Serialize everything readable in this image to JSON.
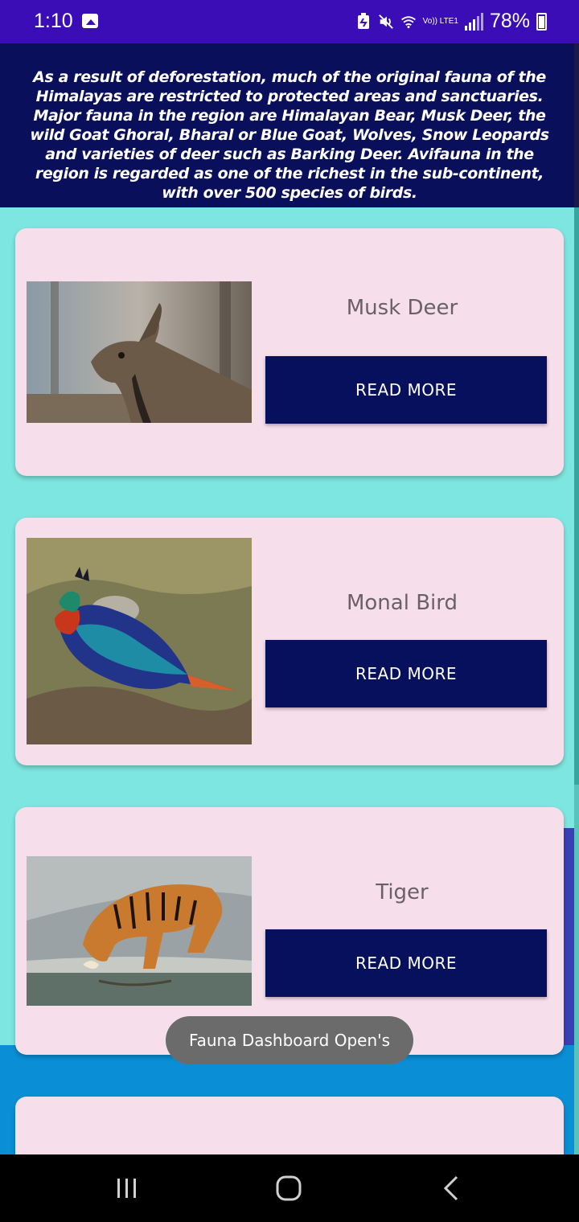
{
  "status_bar": {
    "time": "1:10",
    "battery": "78%",
    "icons": [
      "image-icon",
      "battery-saver-icon",
      "mute-icon",
      "wifi-icon",
      "volte-lte-icon",
      "signal-icon",
      "battery-icon"
    ],
    "volte_label": "Vo)) LTE1"
  },
  "header": {
    "text": "As a result of deforestation, much of the original fauna of the Himalayas are restricted to protected areas and sanctuaries. Major fauna in the region are Himalayan Bear, Musk Deer, the wild Goat Ghoral, Bharal or Blue Goat, Wolves, Snow Leopards and varieties of deer such as Barking Deer. Avifauna in the region is regarded as one of the richest in the sub-continent, with over 500 species of birds."
  },
  "cards": [
    {
      "title": "Musk Deer",
      "button": "READ MORE",
      "image": "musk-deer-photo"
    },
    {
      "title": "Monal Bird",
      "button": "READ MORE",
      "image": "monal-bird-photo"
    },
    {
      "title": "Tiger",
      "button": "READ MORE",
      "image": "tiger-photo"
    },
    {
      "title": "",
      "button": "",
      "image": ""
    }
  ],
  "toast": {
    "text": "Fauna Dashboard Open's"
  },
  "nav": {
    "icons": [
      "recent-apps-icon",
      "home-icon",
      "back-icon"
    ]
  },
  "colors": {
    "status_bar": "#3a0db6",
    "header_bg": "#0a0f5c",
    "page_bg": "#7ee6e0",
    "card_bg": "#f6dfea",
    "button_bg": "#07105c"
  }
}
